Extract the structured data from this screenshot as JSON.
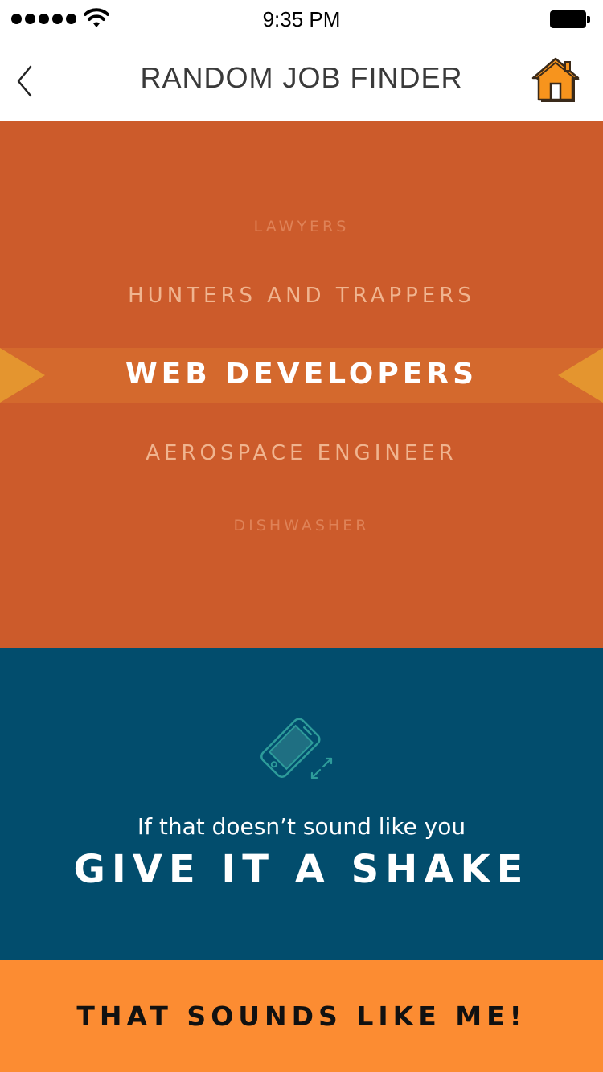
{
  "status_bar": {
    "time": "9:35 PM",
    "signal_icon": "signal-dots-icon",
    "wifi_icon": "wifi-icon",
    "battery_icon": "battery-icon"
  },
  "nav": {
    "title": "RANDOM JOB FINDER",
    "back_icon": "chevron-left-icon",
    "home_icon": "home-icon"
  },
  "picker": {
    "jobs": [
      "LAWYERS",
      "HUNTERS AND TRAPPERS",
      "WEB DEVELOPERS",
      "AEROSPACE ENGINEER",
      "DISHWASHER"
    ],
    "selected": "WEB DEVELOPERS"
  },
  "shake": {
    "icon": "shake-phone-icon",
    "hint": "If that doesn’t sound like you",
    "cta": "GIVE IT A SHAKE"
  },
  "confirm": {
    "label": "THAT SOUNDS LIKE ME!"
  },
  "colors": {
    "picker_bg": "#cc5b2b",
    "selected_band": "#d4692d",
    "selected_arrows": "#e4952f",
    "shake_bg": "#024d6d",
    "confirm_bg": "#fc8c32",
    "home_icon": "#f7941d"
  }
}
